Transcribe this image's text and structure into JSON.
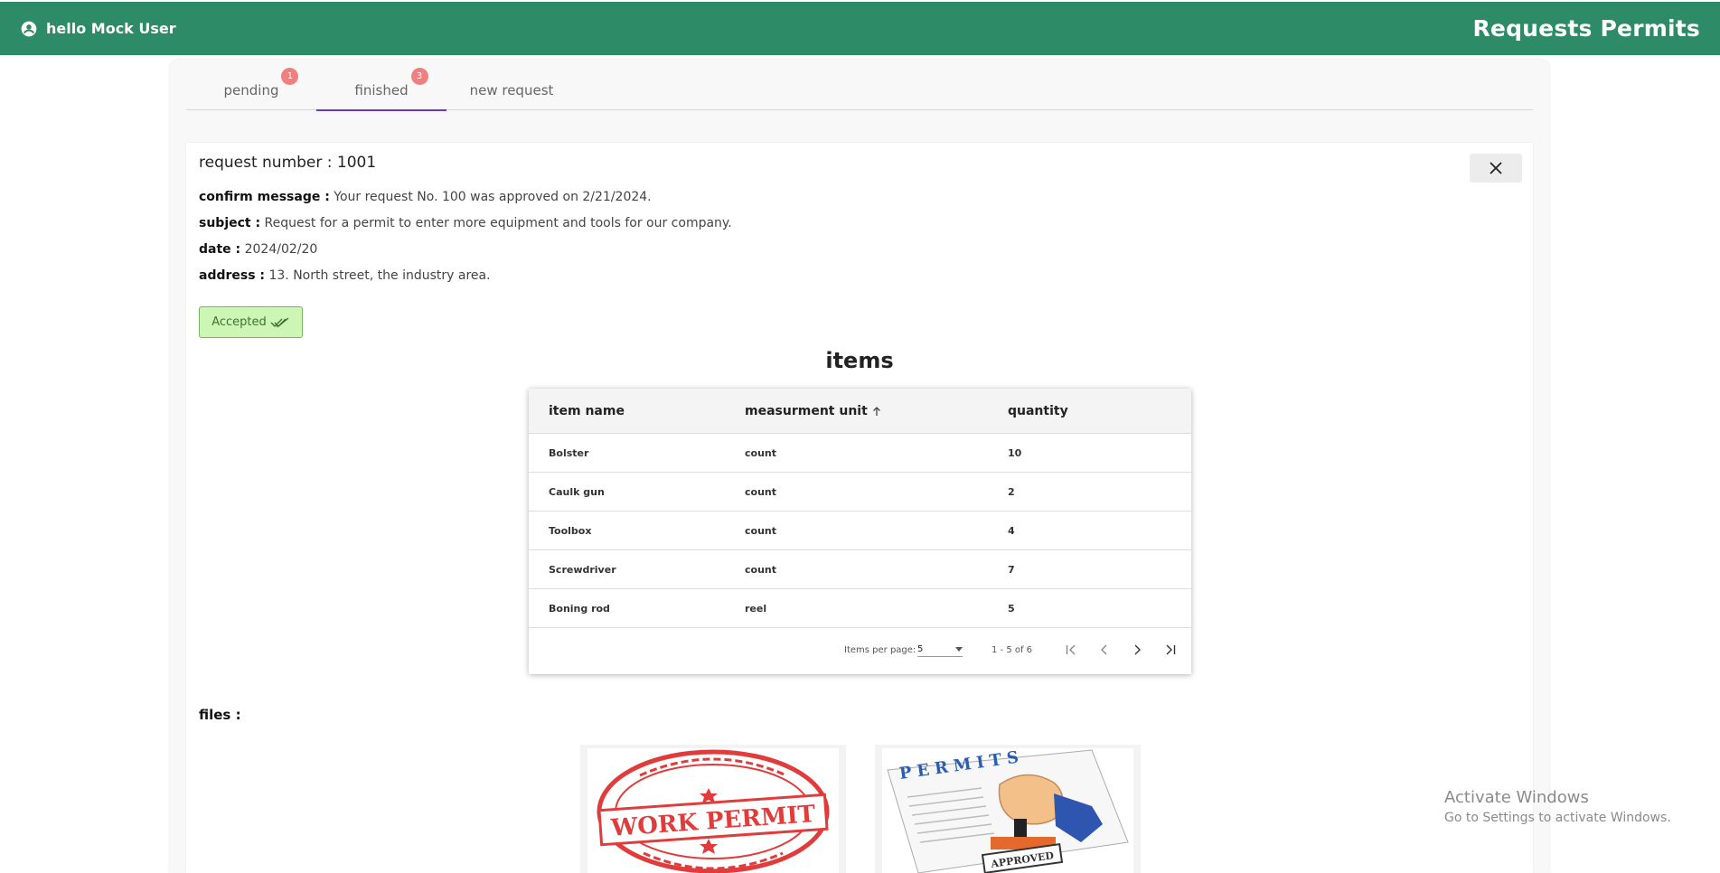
{
  "header": {
    "greeting": "hello Mock User",
    "title": "Requests Permits",
    "color": "#2e8b67"
  },
  "tabs": [
    {
      "label": "pending",
      "badge": "1"
    },
    {
      "label": "finished",
      "badge": "3",
      "active": true
    },
    {
      "label": "new request"
    }
  ],
  "request": {
    "number_label": "request number : 1001",
    "confirm_key": "confirm message :",
    "confirm_value": "Your request No. 100 was approved on 2/21/2024.",
    "subject_key": "subject :",
    "subject_value": "Request for a permit to enter more equipment and tools for our company.",
    "date_key": "date :",
    "date_value": "2024/02/20",
    "address_key": "address :",
    "address_value": "13. North street, the industry area.",
    "status": "Accepted"
  },
  "items": {
    "title": "items",
    "headers": {
      "name": "item name",
      "unit": "measurment unit",
      "quantity": "quantity"
    },
    "rows": [
      {
        "name": "Bolster",
        "unit": "count",
        "quantity": "10"
      },
      {
        "name": "Caulk gun",
        "unit": "count",
        "quantity": "2"
      },
      {
        "name": "Toolbox",
        "unit": "count",
        "quantity": "4"
      },
      {
        "name": "Screwdriver",
        "unit": "count",
        "quantity": "7"
      },
      {
        "name": "Boning rod",
        "unit": "reel",
        "quantity": "5"
      }
    ],
    "paginator": {
      "label": "Items per page:",
      "page_size": "5",
      "range": "1 - 5 of 6"
    }
  },
  "files": {
    "label": "files :",
    "stamp_text": "WORK PERMIT",
    "permits_text": "PERMITS",
    "approved_text": "APPROVED"
  },
  "watermark": {
    "line1": "Activate Windows",
    "line2": "Go to Settings to activate Windows."
  }
}
